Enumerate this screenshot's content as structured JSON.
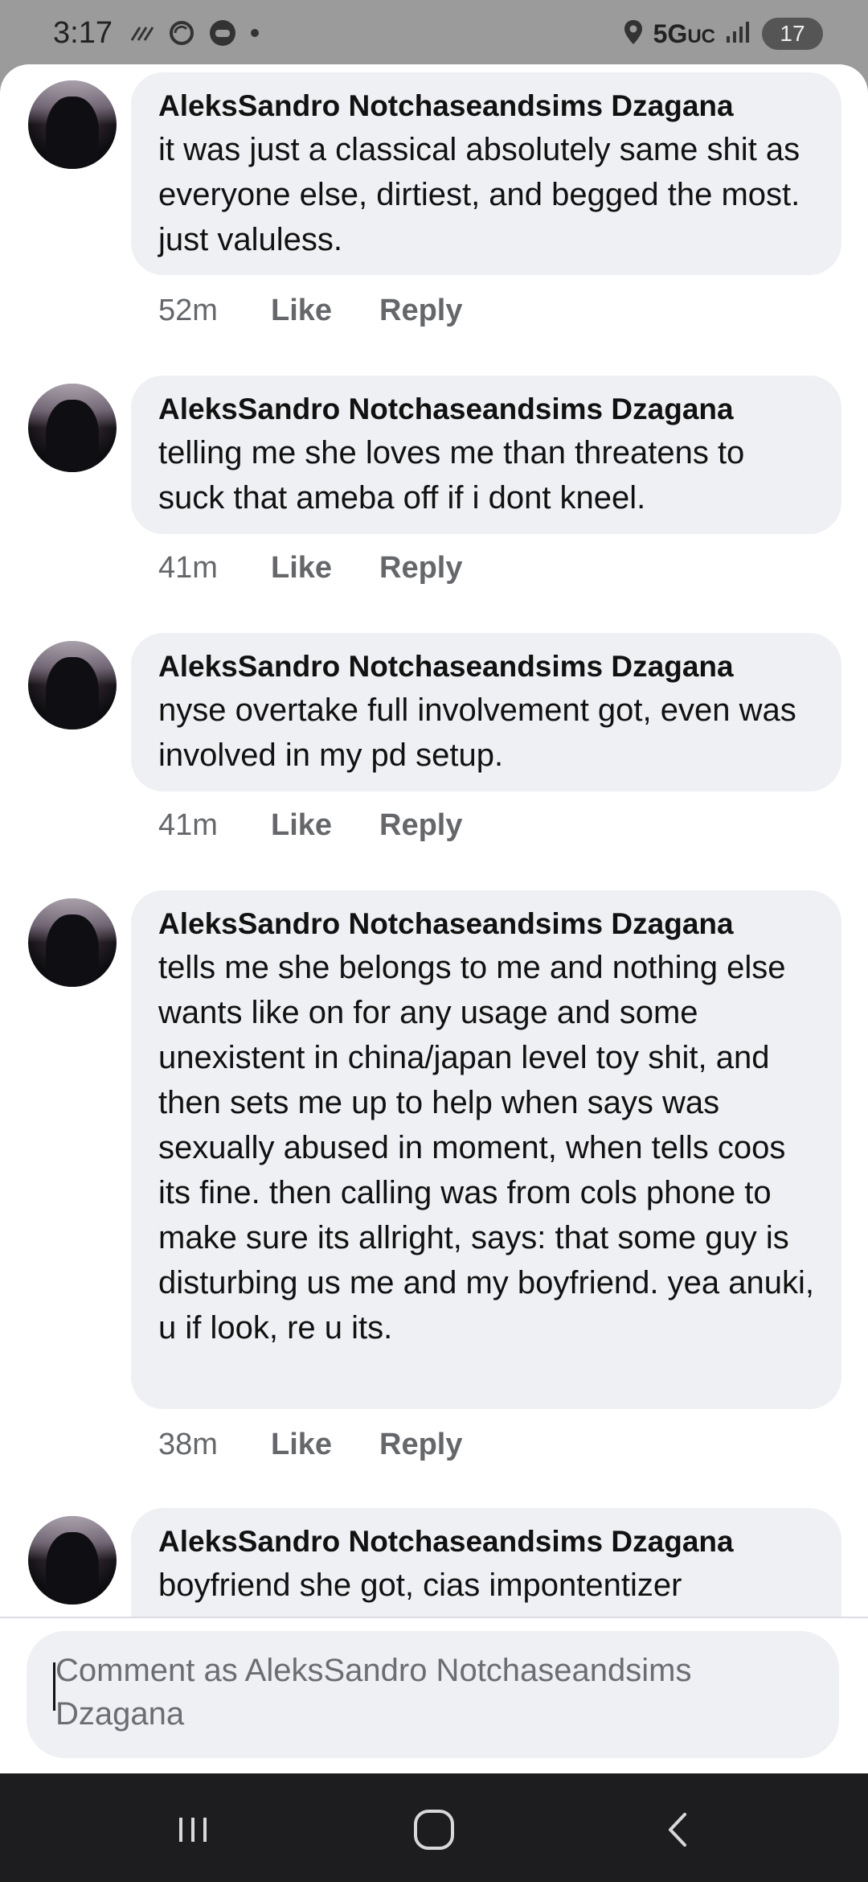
{
  "status_bar": {
    "time": "3:17",
    "network": "5G",
    "network_sub": "UC",
    "battery": "17",
    "icons": [
      "wifi-calling-icon",
      "sync-icon",
      "game-icon",
      "dot-icon",
      "location-icon",
      "signal-icon"
    ]
  },
  "comments": [
    {
      "author": "AleksSandro Notchaseandsims Dzagana",
      "text": "it was just a classical absolutely same shit as everyone else, dirtiest, and begged the most. just valuless.",
      "time": "52m",
      "like_label": "Like",
      "reply_label": "Reply"
    },
    {
      "author": "AleksSandro Notchaseandsims Dzagana",
      "text": "telling me she loves me than threatens to suck that ameba off if i dont kneel.",
      "time": "41m",
      "like_label": "Like",
      "reply_label": "Reply"
    },
    {
      "author": "AleksSandro Notchaseandsims Dzagana",
      "text": "nyse overtake full involvement got, even was involved in my pd setup.",
      "time": "41m",
      "like_label": "Like",
      "reply_label": "Reply"
    },
    {
      "author": "AleksSandro Notchaseandsims Dzagana",
      "text": "tells me she belongs to me and nothing else wants like on for any usage and some unexistent in china/japan level toy shit, and then sets me up to help when says was sexually abused in moment, when tells coos its fine. then calling was from cols phone to make sure its allright, says: that some guy is disturbing us me and my boyfriend. yea anuki, u if look, re u its.",
      "time": "38m",
      "like_label": "Like",
      "reply_label": "Reply"
    },
    {
      "author": "AleksSandro Notchaseandsims Dzagana",
      "text": "boyfriend she got, cias impontentizer"
    }
  ],
  "composer": {
    "placeholder": "Comment as AleksSandro Notchaseandsims Dzagana"
  },
  "nav_bar": {
    "recents_icon": "recents-icon",
    "home_icon": "home-icon",
    "back_icon": "back-icon"
  },
  "colors": {
    "bubble_bg": "#eff0f3",
    "meta_text": "#65676b",
    "status_bar_bg": "#9b9b9b",
    "nav_bar_bg": "#1d1d1f"
  }
}
